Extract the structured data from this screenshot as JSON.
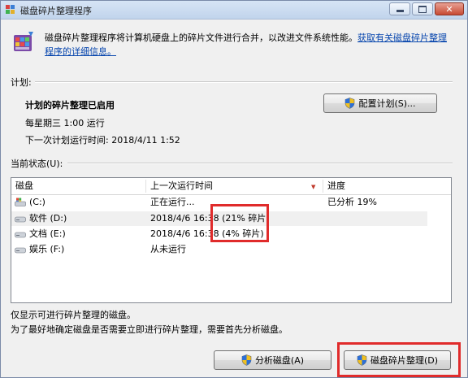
{
  "window": {
    "title": "磁盘碎片整理程序",
    "close_glyph": "✕"
  },
  "intro": {
    "text": "磁盘碎片整理程序将计算机硬盘上的碎片文件进行合并，以改进文件系统性能。",
    "link": "获取有关磁盘碎片整理程序的详细信息。"
  },
  "schedule": {
    "group_label": "计划:",
    "status": "计划的碎片整理已启用",
    "frequency": "每星期三  1:00 运行",
    "next_run": "下一次计划运行时间: 2018/4/11 1:52",
    "configure_button": "配置计划(S)..."
  },
  "current_status": {
    "group_label": "当前状态(U):",
    "columns": {
      "disk": "磁盘",
      "last_run": "上一次运行时间",
      "progress": "进度"
    },
    "rows": [
      {
        "disk": "(C:)",
        "last_run": "正在运行...",
        "progress": "已分析 19%"
      },
      {
        "disk": "软件 (D:)",
        "last_run": "2018/4/6 16:38 (21% 碎片)",
        "progress": ""
      },
      {
        "disk": "文档 (E:)",
        "last_run": "2018/4/6 16:38 (4% 碎片)",
        "progress": ""
      },
      {
        "disk": "娱乐 (F:)",
        "last_run": "从未运行",
        "progress": ""
      }
    ]
  },
  "footer": {
    "note1": "仅显示可进行碎片整理的磁盘。",
    "note2": "为了最好地确定磁盘是否需要立即进行碎片整理，需要首先分析磁盘。",
    "analyze_button": "分析磁盘(A)",
    "defrag_button": "磁盘碎片整理(D)"
  },
  "colors": {
    "highlight_box": "#e02b2b",
    "link": "#0645ad"
  },
  "icons": {
    "app": "defrag-app-icon",
    "shield": "uac-shield-icon",
    "system_drive": "system-drive-icon",
    "drive": "hard-drive-icon"
  }
}
